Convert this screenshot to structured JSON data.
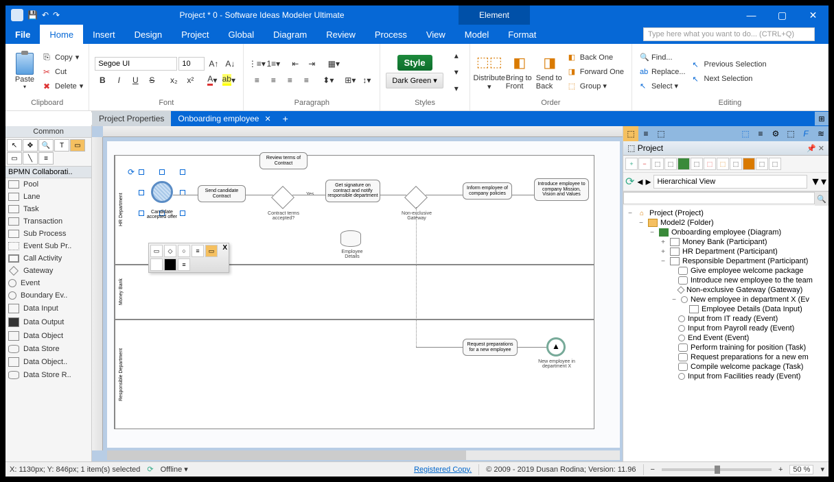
{
  "title": "Project *  0  - Software Ideas Modeler Ultimate",
  "context_tab": "Element",
  "menu": {
    "file": "File",
    "home": "Home",
    "insert": "Insert",
    "design": "Design",
    "project": "Project",
    "global": "Global",
    "diagram": "Diagram",
    "review": "Review",
    "process": "Process",
    "view": "View",
    "model": "Model",
    "format": "Format"
  },
  "search_placeholder": "Type here what you want to do...   (CTRL+Q)",
  "ribbon": {
    "clipboard": {
      "label": "Clipboard",
      "paste": "Paste",
      "copy": "Copy",
      "cut": "Cut",
      "delete": "Delete"
    },
    "font": {
      "label": "Font",
      "name": "Segoe UI",
      "size": "10"
    },
    "paragraph": {
      "label": "Paragraph"
    },
    "styles": {
      "label": "Styles",
      "style_btn": "Style",
      "current": "Dark Green"
    },
    "order": {
      "label": "Order",
      "distribute": "Distribute",
      "btf": "Bring to Front",
      "stb": "Send to Back",
      "back_one": "Back One",
      "forward_one": "Forward One",
      "group": "Group"
    },
    "editing": {
      "label": "Editing",
      "find": "Find...",
      "replace": "Replace...",
      "select": "Select",
      "prev_sel": "Previous Selection",
      "next_sel": "Next Selection"
    }
  },
  "tabs": {
    "inactive": "Project Properties",
    "active": "Onboarding employee"
  },
  "toolbox": {
    "common": "Common",
    "category": "BPMN  Collaborati..",
    "items": [
      "Pool",
      "Lane",
      "Task",
      "Transaction",
      "Sub Process",
      "Event Sub Pr..",
      "Call Activity",
      "Gateway",
      "Event",
      "Boundary Ev..",
      "Data Input",
      "Data Output",
      "Data Object",
      "Data Store",
      "Data Object..",
      "Data Store R.."
    ]
  },
  "canvas": {
    "pool1": "HR Department",
    "pool2": "Money Bank",
    "pool3": "Responsible Department",
    "sel_label": "Candidate accepted offer",
    "task_send": "Send candidate Contract",
    "task_review": "Review terms of Contract",
    "gw1_label": "Contract terms accepted?",
    "gw1_yes": "Yes",
    "task_sign": "Get signature on contract and notify responsible department",
    "ds_label": "Employee Details",
    "gw2_label": "Non-exclusive Gateway",
    "task_inform": "Inform employee of company policies",
    "task_intro": "Introduce employee to company Mission, Vision and Values",
    "task_req": "Request preparations for a new employee",
    "ev_new": "New employee in department X"
  },
  "project_panel": {
    "title": "Project",
    "view_mode": "Hierarchical View",
    "tree": {
      "root": "Project (Project)",
      "folder": "Model2 (Folder)",
      "diagram": "Onboarding employee (Diagram)",
      "p1": "Money Bank (Participant)",
      "p2": "HR Department (Participant)",
      "p3": "Responsible Department (Participant)",
      "t1": "Give employee welcome package",
      "t2": "Introduce new employee to the team",
      "g1": "Non-exclusive Gateway (Gateway)",
      "e1": "New employee in department X (Ev",
      "d1": "Employee Details (Data Input)",
      "e2": "Input from IT ready (Event)",
      "e3": "Input from Payroll ready (Event)",
      "e4": "End Event (Event)",
      "t3": "Perform training for position (Task)",
      "t4": "Request preparations for a new em",
      "t5": "Compile welcome package (Task)",
      "e5": "Input from Facilities ready (Event)"
    }
  },
  "status": {
    "coords": "X: 1130px; Y: 846px; 1 item(s) selected",
    "offline": "Offline",
    "reg": "Registered Copy.",
    "copyright": "© 2009 - 2019 Dusan Rodina; Version: 11.96",
    "zoom": "50 %"
  }
}
